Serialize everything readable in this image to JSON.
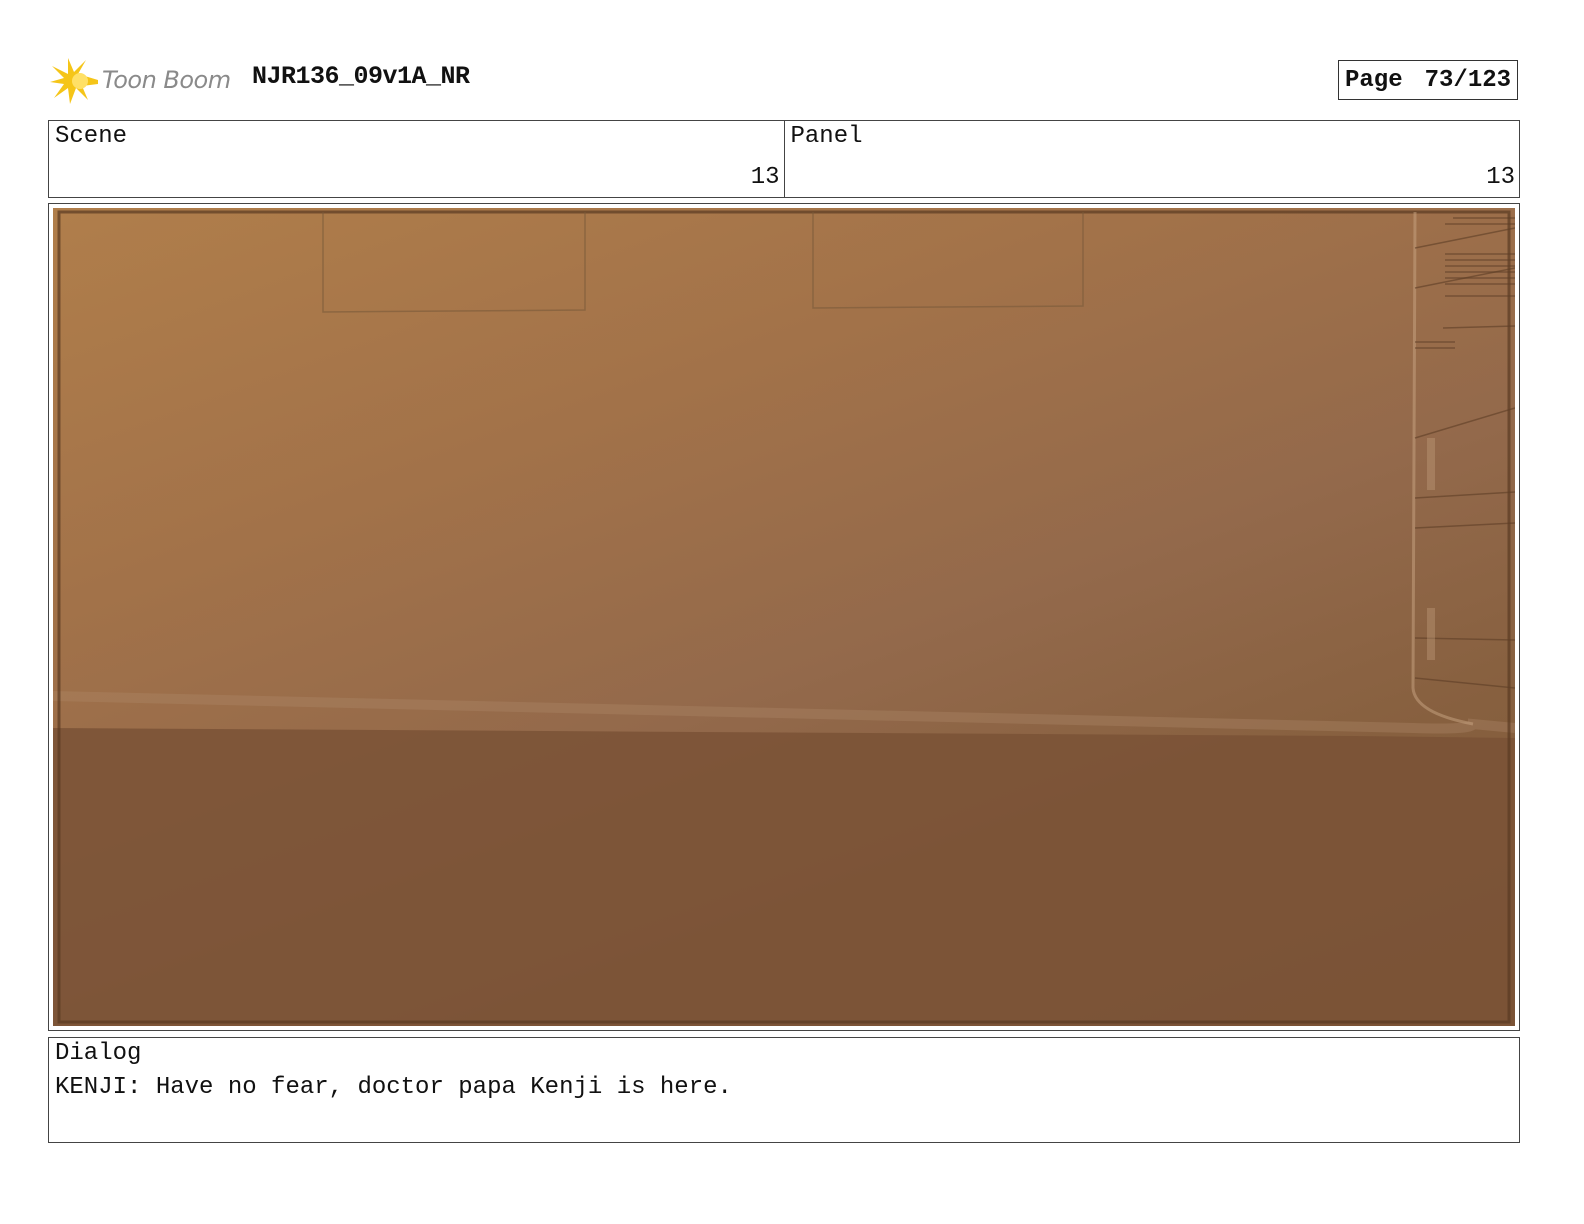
{
  "header": {
    "logo_text": "Toon Boom",
    "project_title": "NJR136_09v1A_NR",
    "page_label": "Page",
    "page_value": "73/123"
  },
  "info": {
    "scene_label": "Scene",
    "scene_value": "13",
    "panel_label": "Panel",
    "panel_value": "13"
  },
  "dialog": {
    "label": "Dialog",
    "text": "KENJI: Have no fear, doctor papa Kenji is here."
  },
  "colors": {
    "logo_burst": "#f5c518",
    "logo_text": "#8a8a8a",
    "frame_wall": "#a27249",
    "frame_floor": "#7a5236"
  }
}
